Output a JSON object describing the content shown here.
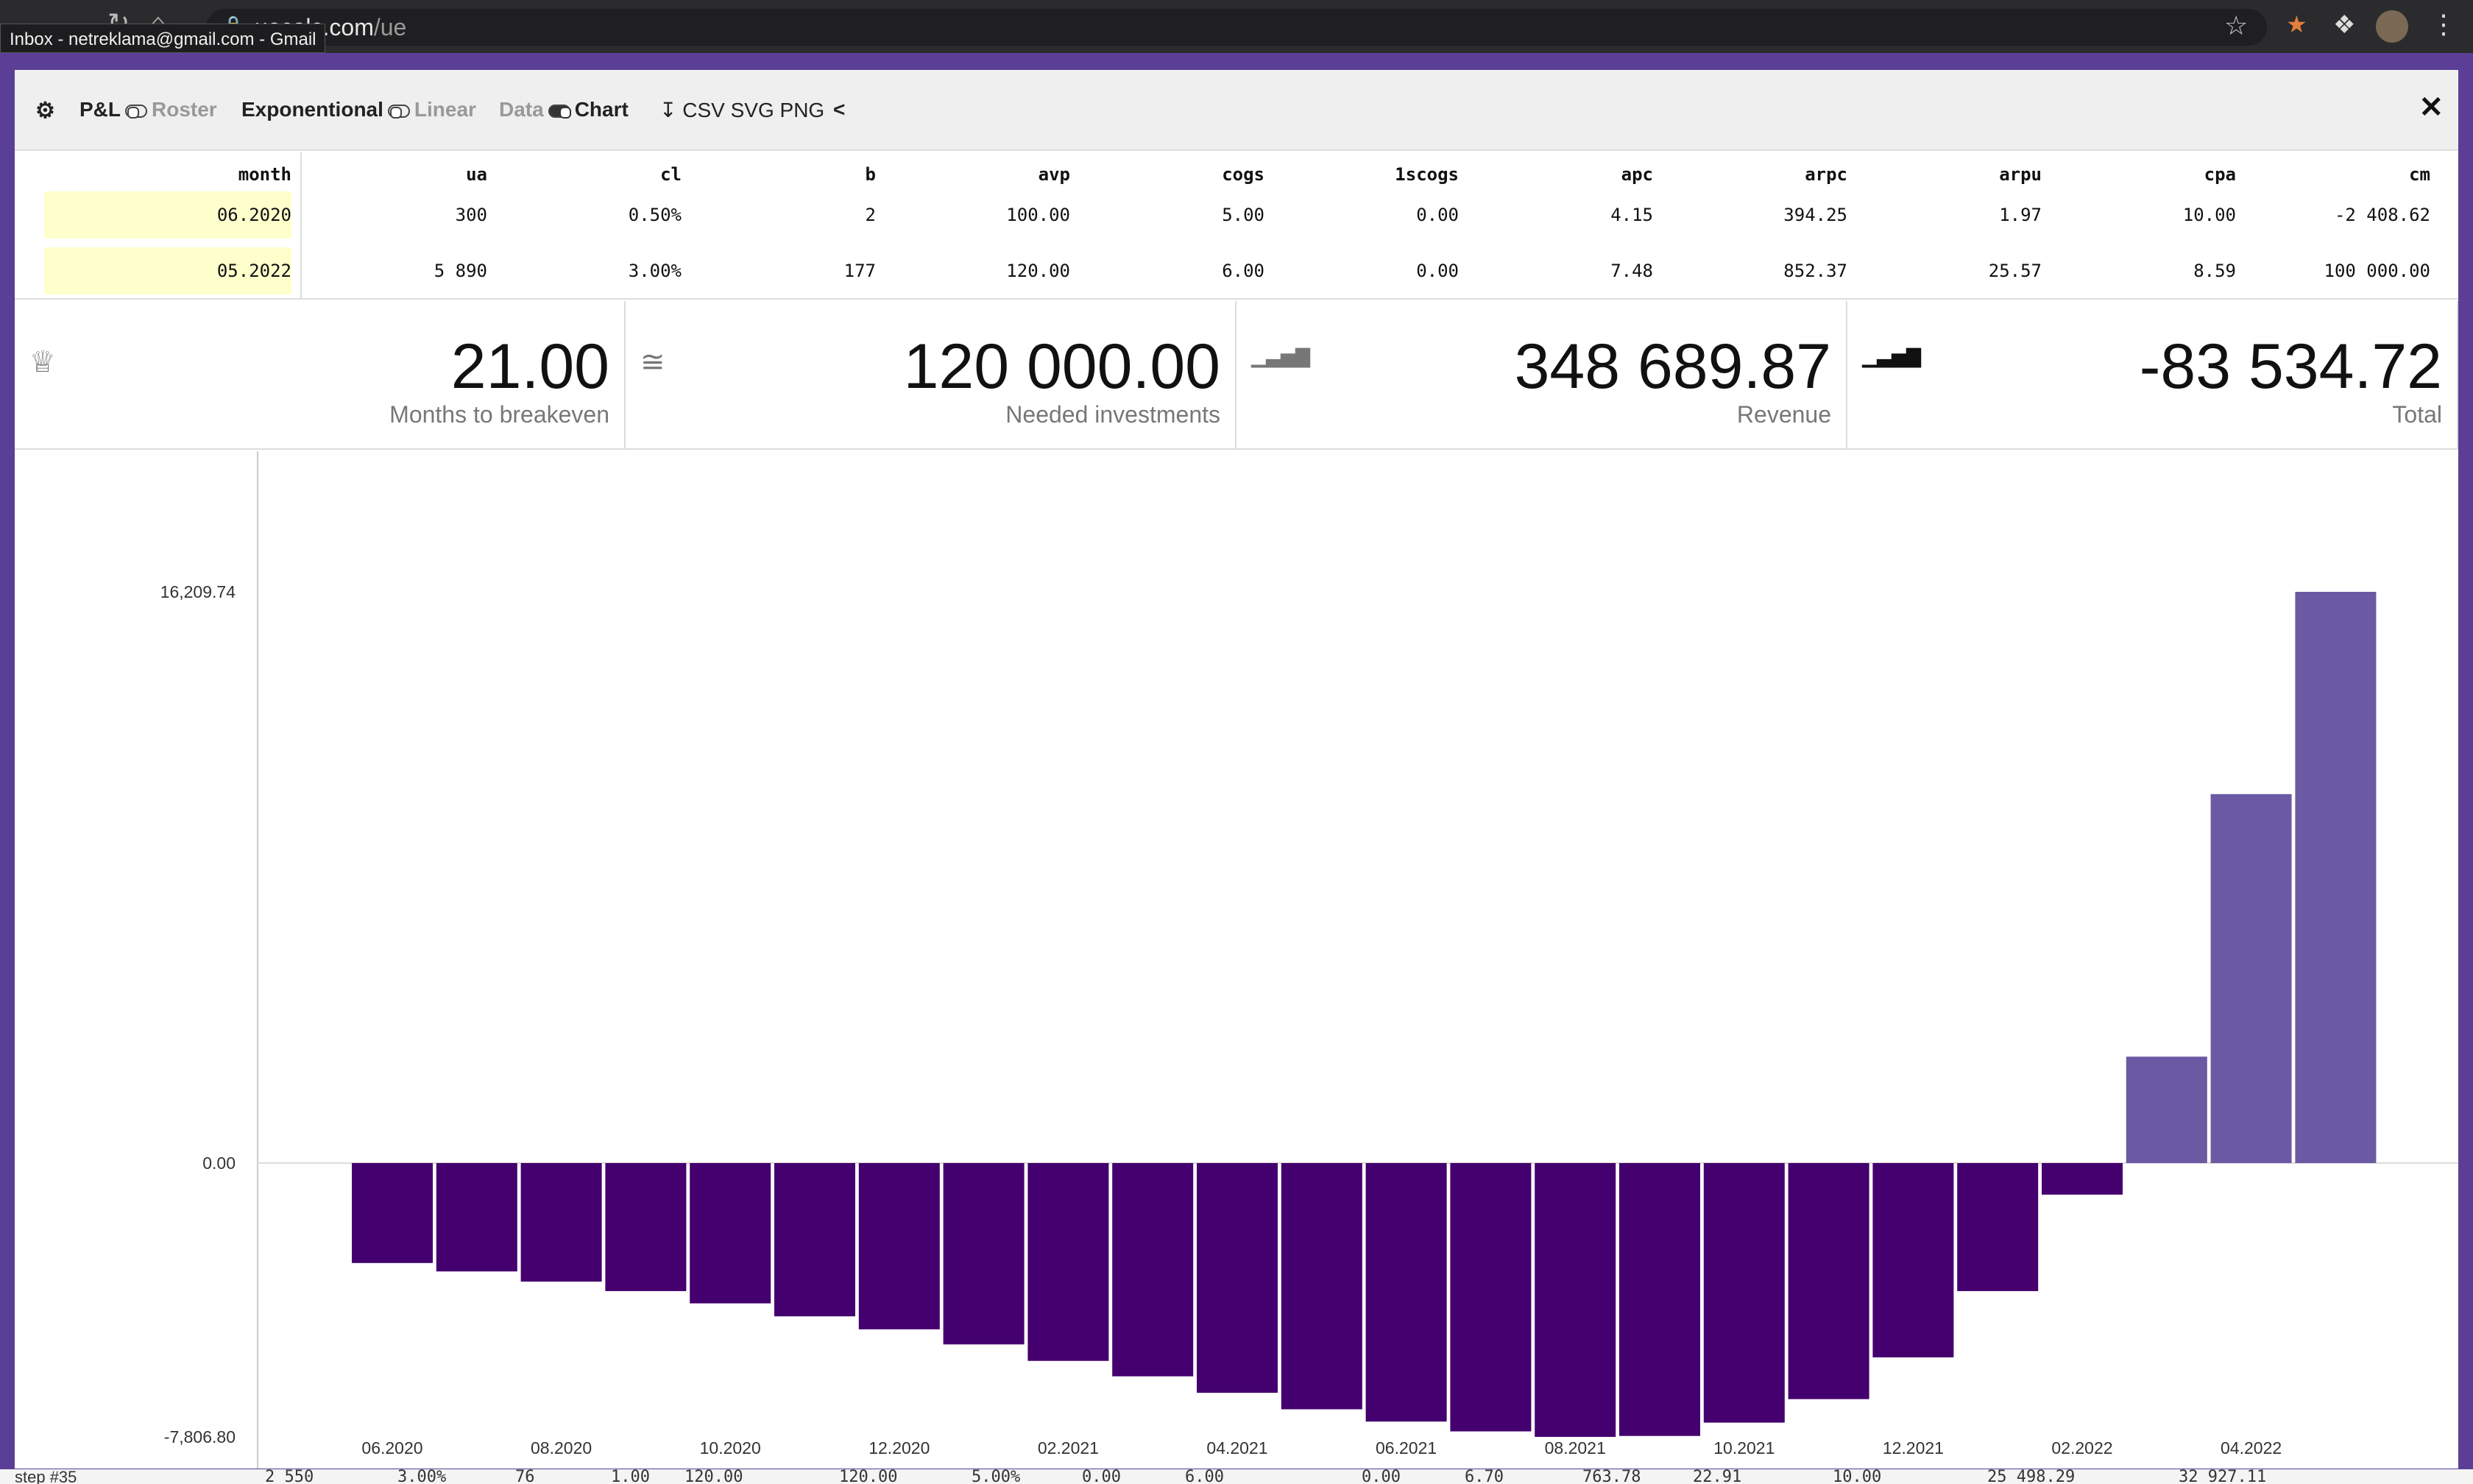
{
  "browser": {
    "url_host": "uecalc.com",
    "url_path": "/ue",
    "tooltip": "Inbox - netreklama@gmail.com - Gmail"
  },
  "toolbar": {
    "pl_label": "P&L",
    "roster_label": "Roster",
    "exponential_label": "Exponentional",
    "linear_label": "Linear",
    "data_label": "Data",
    "chart_label": "Chart",
    "export_label": "CSV SVG PNG"
  },
  "table": {
    "headers": [
      "month",
      "ua",
      "cl",
      "b",
      "avp",
      "cogs",
      "1scogs",
      "apc",
      "arpc",
      "arpu",
      "cpa",
      "cm"
    ],
    "rows": [
      [
        "06.2020",
        "300",
        "0.50%",
        "2",
        "100.00",
        "5.00",
        "0.00",
        "4.15",
        "394.25",
        "1.97",
        "10.00",
        "-2 408.62"
      ],
      [
        "05.2022",
        "5 890",
        "3.00%",
        "177",
        "120.00",
        "6.00",
        "0.00",
        "7.48",
        "852.37",
        "25.57",
        "8.59",
        "100 000.00"
      ]
    ]
  },
  "kpis": [
    {
      "icon": "trophy-icon",
      "value": "21.00",
      "label": "Months to breakeven"
    },
    {
      "icon": "approx-icon",
      "value": "120 000.00",
      "label": "Needed investments"
    },
    {
      "icon": "bar-chart-icon",
      "value": "348 689.87",
      "label": "Revenue"
    },
    {
      "icon": "bar-chart-icon",
      "value": "-83 534.72",
      "label": "Total"
    }
  ],
  "colors": {
    "negative": "#44006e",
    "positive": "#6b59a3",
    "accent": "#5b3f96"
  },
  "chart_data": {
    "type": "bar",
    "categories": [
      "06.2020",
      "07.2020",
      "08.2020",
      "09.2020",
      "10.2020",
      "11.2020",
      "12.2020",
      "01.2021",
      "02.2021",
      "03.2021",
      "04.2021",
      "05.2021",
      "06.2021",
      "07.2021",
      "08.2021",
      "09.2021",
      "10.2021",
      "11.2021",
      "12.2021",
      "01.2022",
      "02.2022",
      "03.2022",
      "04.2022",
      "05.2022"
    ],
    "x_tick_labels": [
      "06.2020",
      "08.2020",
      "10.2020",
      "12.2020",
      "02.2021",
      "04.2021",
      "06.2021",
      "08.2021",
      "10.2021",
      "12.2021",
      "02.2022",
      "04.2022"
    ],
    "values": [
      -2850,
      -3090,
      -3380,
      -3650,
      -4000,
      -4370,
      -4740,
      -5170,
      -5640,
      -6080,
      -6550,
      -7020,
      -7370,
      -7650,
      -7806.8,
      -7780,
      -7400,
      -6730,
      -5540,
      -3650,
      -900,
      3020,
      10470,
      16209.74
    ],
    "y_tick_labels": [
      "16,209.74",
      "0.00",
      "-7,806.80"
    ],
    "y_ticks": [
      16209.74,
      0,
      -7806.8
    ],
    "ylim": [
      -9860,
      17400
    ],
    "grid": false,
    "legend": "none"
  },
  "bottom": {
    "row_label": "step #35",
    "cells": [
      "2 550",
      "3.00%",
      "76",
      "1.00",
      "120.00",
      "120.00",
      "5.00%",
      "0.00",
      "6.00",
      "0.00",
      "6.70",
      "763.78",
      "22.91",
      "10.00",
      "25 498.29",
      "32 927.11"
    ]
  }
}
